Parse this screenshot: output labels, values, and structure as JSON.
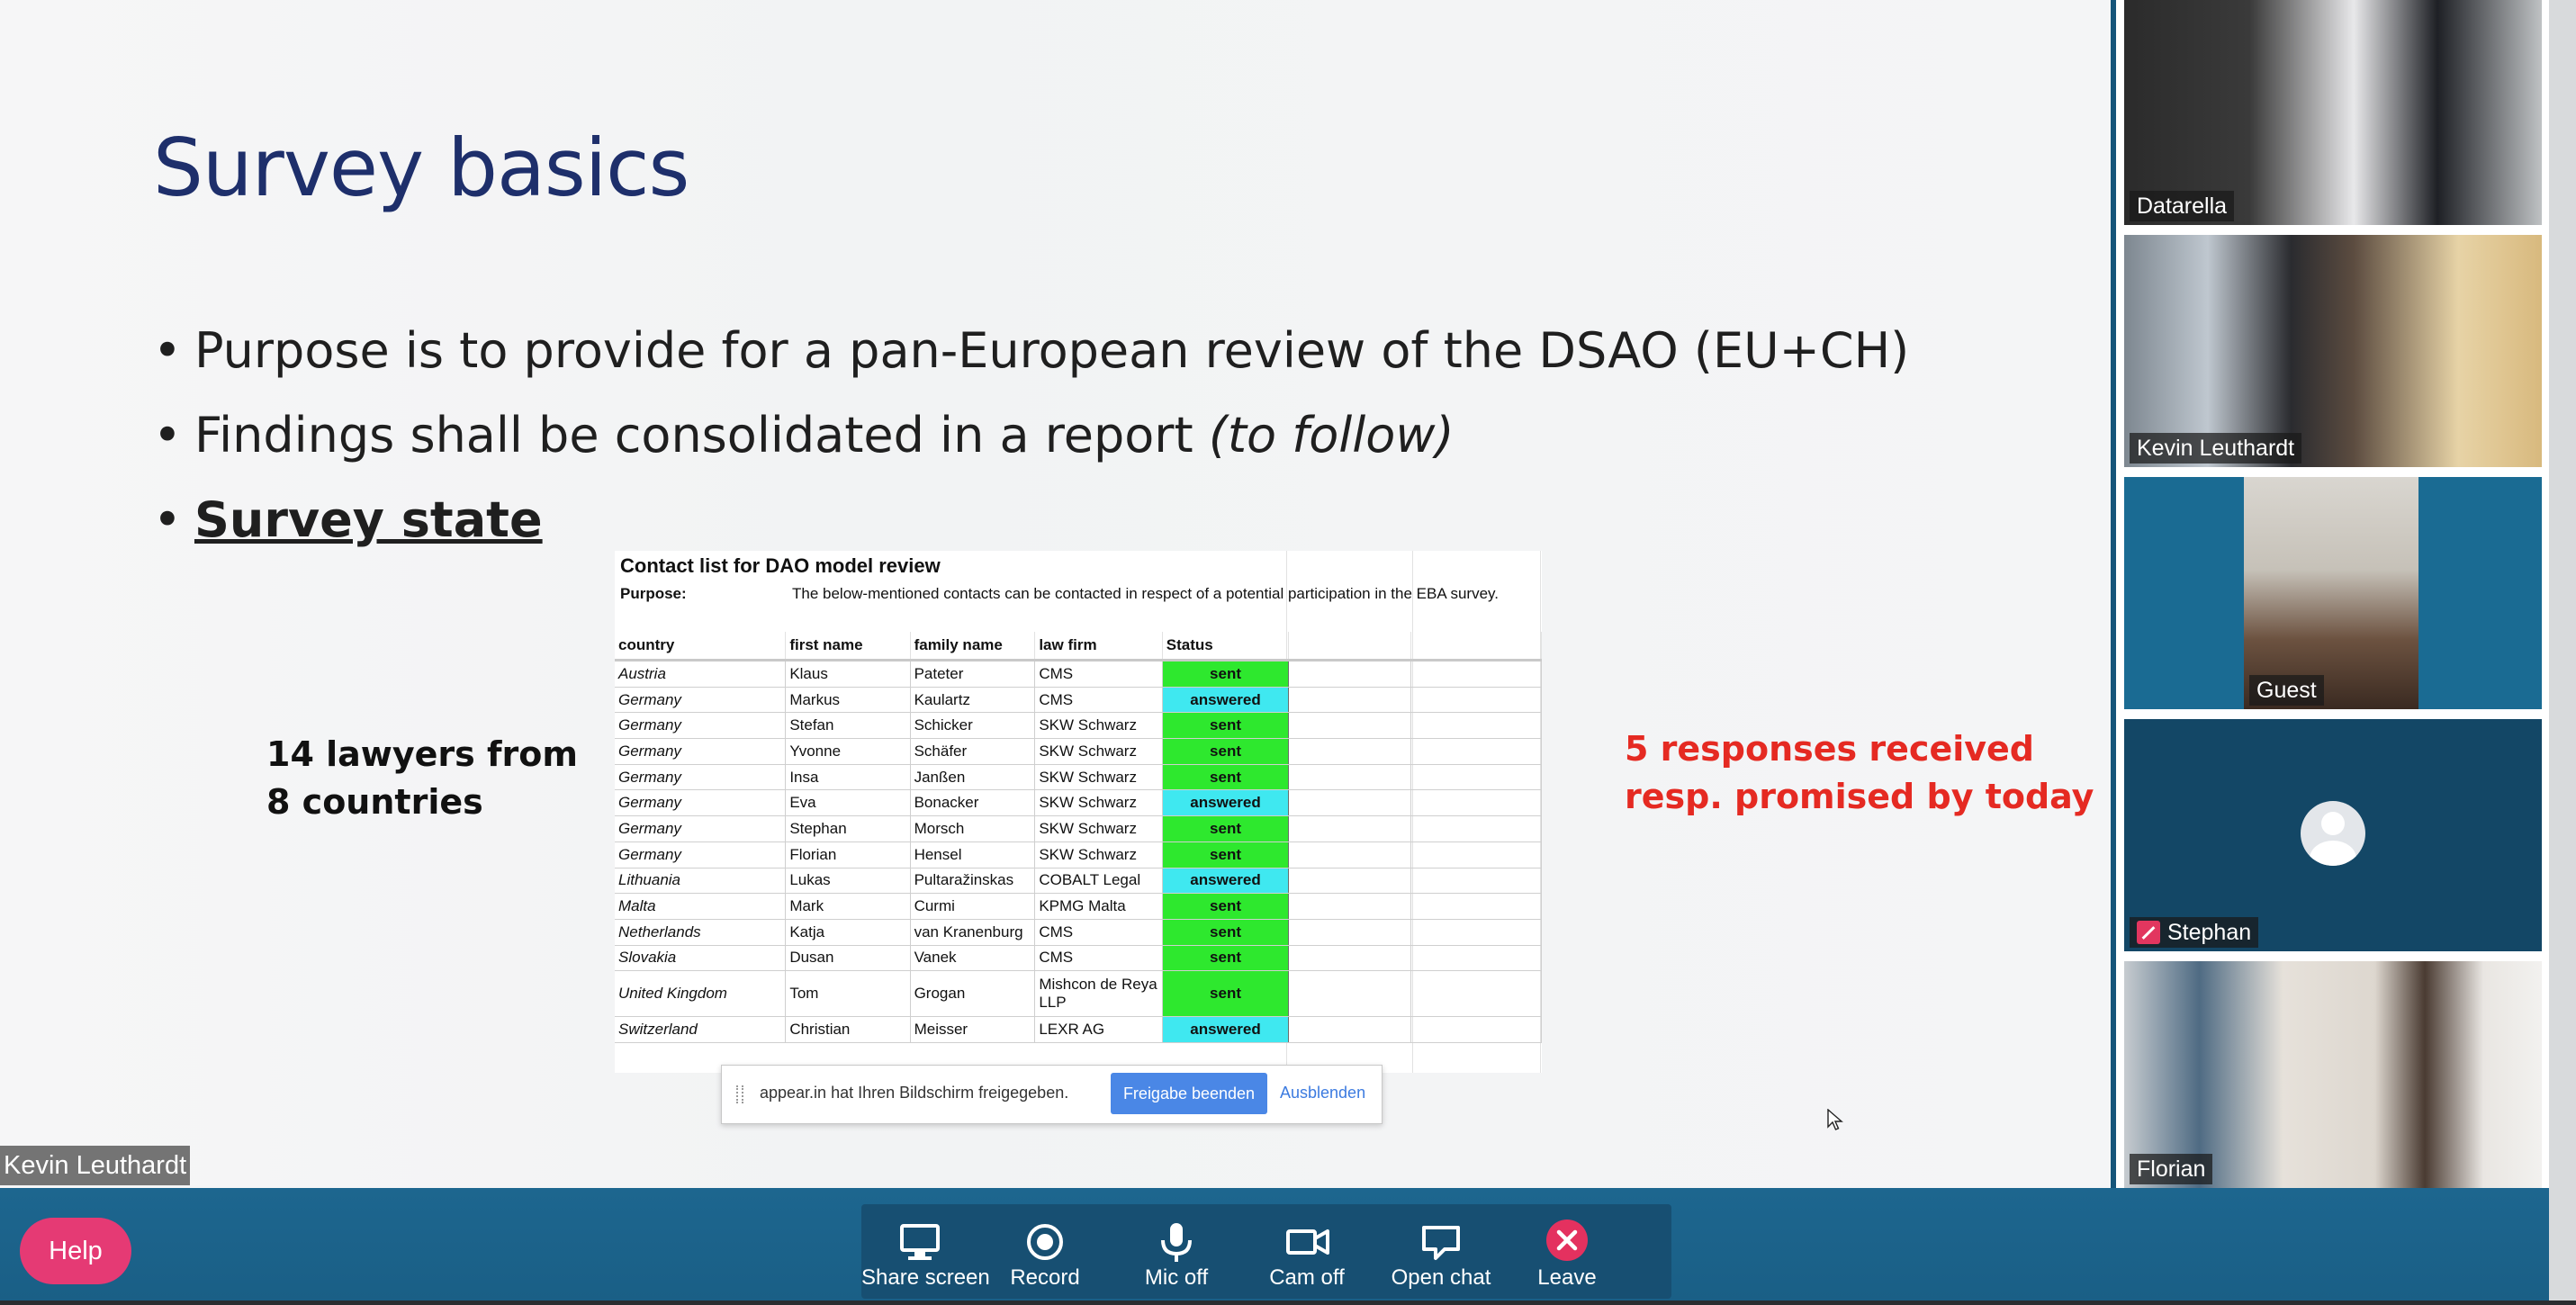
{
  "slide": {
    "title": "Survey basics",
    "bullets": {
      "b1": "Purpose is to provide for a pan-European review of the DSAO (EU+CH)",
      "b2_main": "Findings shall be consolidated in a report ",
      "b2_italic": "(to follow)",
      "b3": "Survey state"
    },
    "left_note": {
      "line1": "14 lawyers from",
      "line2": "8 countries"
    },
    "right_note": {
      "line1": "5 responses received",
      "line2": "resp. promised by today"
    },
    "colors": {
      "title": "#1e2f6b",
      "right_note": "#e52a22",
      "status_sent": "#2ee82e",
      "status_answered": "#3fe8f0"
    }
  },
  "sheet": {
    "title": "Contact list for DAO model review",
    "purpose_label": "Purpose:",
    "purpose_text": "The below-mentioned contacts can be contacted in respect of a potential participation in the EBA survey.",
    "headers": {
      "country": "country",
      "first": "first name",
      "family": "family name",
      "firm": "law firm",
      "status": "Status"
    },
    "rows": [
      {
        "country": "Austria",
        "first": "Klaus",
        "family": "Pateter",
        "firm": "CMS",
        "status": "sent"
      },
      {
        "country": "Germany",
        "first": "Markus",
        "family": "Kaulartz",
        "firm": "CMS",
        "status": "answered"
      },
      {
        "country": "Germany",
        "first": "Stefan",
        "family": "Schicker",
        "firm": "SKW Schwarz",
        "status": "sent"
      },
      {
        "country": "Germany",
        "first": "Yvonne",
        "family": "Schäfer",
        "firm": "SKW Schwarz",
        "status": "sent"
      },
      {
        "country": "Germany",
        "first": "Insa",
        "family": "Janßen",
        "firm": "SKW Schwarz",
        "status": "sent"
      },
      {
        "country": "Germany",
        "first": "Eva",
        "family": "Bonacker",
        "firm": "SKW Schwarz",
        "status": "answered"
      },
      {
        "country": "Germany",
        "first": "Stephan",
        "family": "Morsch",
        "firm": "SKW Schwarz",
        "status": "sent"
      },
      {
        "country": "Germany",
        "first": "Florian",
        "family": "Hensel",
        "firm": "SKW Schwarz",
        "status": "sent"
      },
      {
        "country": "Lithuania",
        "first": "Lukas",
        "family": "Pultaražinskas",
        "firm": "COBALT Legal",
        "status": "answered"
      },
      {
        "country": "Malta",
        "first": "Mark",
        "family": "Curmi",
        "firm": "KPMG Malta",
        "status": "sent"
      },
      {
        "country": "Netherlands",
        "first": "Katja",
        "family": "van Kranenburg",
        "firm": "CMS",
        "status": "sent"
      },
      {
        "country": "Slovakia",
        "first": "Dusan",
        "family": "Vanek",
        "firm": "CMS",
        "status": "sent"
      },
      {
        "country": "United Kingdom",
        "first": "Tom",
        "family": "Grogan",
        "firm": "Mishcon de Reya LLP",
        "status": "sent"
      },
      {
        "country": "Switzerland",
        "first": "Christian",
        "family": "Meisser",
        "firm": "LEXR AG",
        "status": "answered"
      }
    ]
  },
  "share_notice": {
    "message": "appear.in hat Ihren Bildschirm freigegeben.",
    "stop_label": "Freigabe beenden",
    "hide_label": "Ausblenden"
  },
  "presenter_label": "Kevin Leuthardt",
  "participants": {
    "p1": "Datarella",
    "p2": "Kevin Leuthardt",
    "p3": "Guest",
    "p4": "Stephan",
    "p5": "Florian"
  },
  "toolbar": {
    "help": "Help",
    "share_screen": "Share screen",
    "record": "Record",
    "mic_off": "Mic off",
    "cam_off": "Cam off",
    "open_chat": "Open chat",
    "leave": "Leave"
  },
  "icons": [
    "monitor-icon",
    "record-icon",
    "microphone-icon",
    "camera-icon",
    "chat-icon",
    "close-icon",
    "mic-off-icon",
    "avatar-icon",
    "mouse-cursor-icon"
  ]
}
